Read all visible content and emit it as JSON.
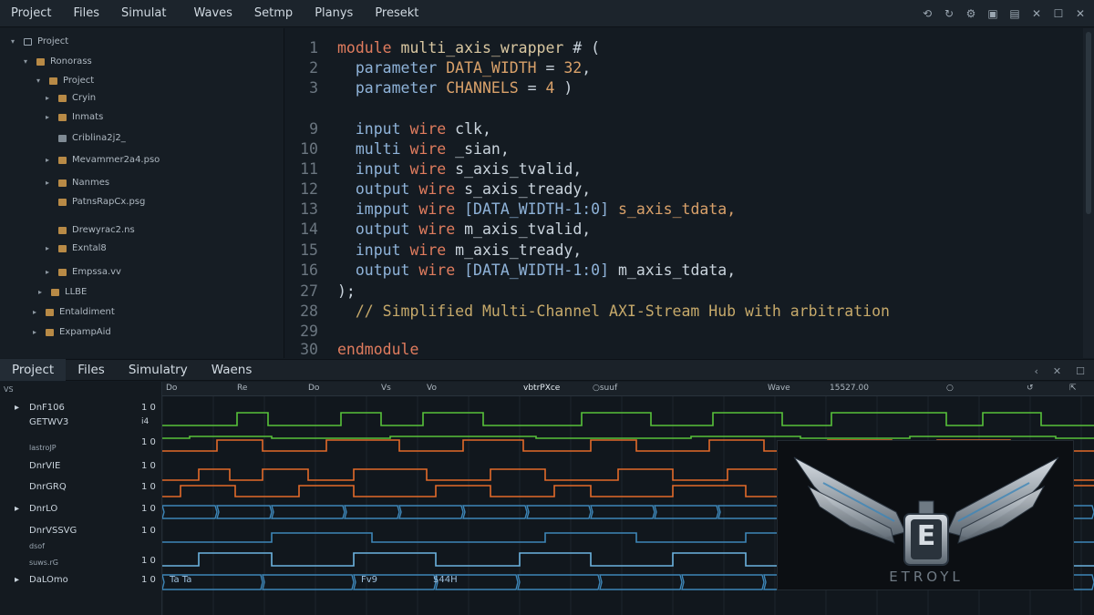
{
  "menubar": {
    "items": [
      "Project",
      "Files",
      "Simulat",
      "Waves",
      "Setmp",
      "Planys",
      "Presekt"
    ],
    "icons": [
      "refresh-icon",
      "sync-icon",
      "gear-icon",
      "save-icon",
      "save-all-icon",
      "close-icon",
      "maximize-icon",
      "close-window-icon"
    ]
  },
  "tree": {
    "items": [
      {
        "label": "Project",
        "sub": ""
      },
      {
        "label": "Ronorass",
        "sub": ""
      },
      {
        "label": "Project",
        "sub": ""
      },
      {
        "label": "Cryin",
        "sub": ""
      },
      {
        "label": "Inmats",
        "sub": ""
      },
      {
        "label": "Criblina2j2_",
        "sub": ""
      },
      {
        "label": "Mevammer2a4.pso",
        "sub": "_"
      },
      {
        "label": "Nanmes",
        "sub": ""
      },
      {
        "label": "PatnsRapCx.psg",
        "sub": "_"
      },
      {
        "label": "Drewyrac2.ns",
        "sub": "_"
      },
      {
        "label": "Exntal8",
        "sub": ""
      },
      {
        "label": "Empssa.vv",
        "sub": ""
      },
      {
        "label": "LLBE",
        "sub": "-"
      },
      {
        "label": "Entaldiment",
        "sub": ""
      },
      {
        "label": "ExpampAid",
        "sub": ""
      }
    ]
  },
  "editor": {
    "line_numbers": [
      "1",
      "2",
      "3",
      "9",
      "10",
      "11",
      "12",
      "13",
      "14",
      "15",
      "16",
      "27",
      "28",
      "29",
      "30"
    ],
    "code": {
      "l1_kw": "module",
      "l1_id": "multi_axis_wrapper",
      "l1_rest": " # (",
      "l2_kw": "parameter",
      "l2_par": "DATA_WIDTH",
      "l2_eq": " = ",
      "l2_num": "32",
      "l2_end": ",",
      "l3_kw": "parameter",
      "l3_par": "CHANNELS",
      "l3_eq": " = ",
      "l3_num": "4",
      "l3_end": " )",
      "l9_a": "input",
      "l9_b": "wire",
      "l9_c": "clk,",
      "l10_a": "multi",
      "l10_b": "wire",
      "l10_c": "_sian,",
      "l11_a": "input",
      "l11_b": "wire",
      "l11_c": "s_axis_tvalid,",
      "l12_a": "output",
      "l12_b": "wire",
      "l12_c": "s_axis_tready,",
      "l13_a": "impput",
      "l13_b": "wire",
      "l13_br": "[DATA_WIDTH-1:0]",
      "l13_c": "s_axis_tdata,",
      "l14_a": "output",
      "l14_b": "wire",
      "l14_c": "m_axis_tvalid,",
      "l15_a": "input",
      "l15_b": "wire",
      "l15_c": "m_axis_tready,",
      "l16_a": "output",
      "l16_b": "wire",
      "l16_br": "[DATA_WIDTH-1:0]",
      "l16_c": "m_axis_tdata,",
      "l27": ");",
      "l28": "// Simplified Multi-Channel AXI-Stream Hub with arbitration",
      "l29": "",
      "l30": "endmodule"
    }
  },
  "bottom_tabs": [
    "Project",
    "Files",
    "Simulatry",
    "Waens"
  ],
  "waves": {
    "ruler": [
      "VS",
      "Do",
      "Re",
      "Do",
      "Vs",
      "Vo",
      "vbtrPXce",
      "○suuf",
      "Wave",
      "15527.00",
      "○",
      "↺",
      "⇱"
    ],
    "signals": [
      {
        "name": "DnF106",
        "val": "1 0",
        "arrow": "▸"
      },
      {
        "name": "GETWV3",
        "val": "i4",
        "arrow": ""
      },
      {
        "name": "lastroJP",
        "val": "1 0",
        "arrow": ""
      },
      {
        "name": "DnrVIE",
        "val": "1 0",
        "arrow": ""
      },
      {
        "name": "DnrGRQ",
        "val": "1 0",
        "arrow": ""
      },
      {
        "name": "DnrLO",
        "val": "1 0",
        "arrow": "▸"
      },
      {
        "name": "DnrVSSVG",
        "val": "1 0",
        "arrow": ""
      },
      {
        "name": "dsof",
        "val": "",
        "arrow": ""
      },
      {
        "name": "suws.rG",
        "val": "1 0",
        "arrow": ""
      },
      {
        "name": "DaLOmo",
        "val": "1 0",
        "arrow": "▸"
      }
    ],
    "bus_labels": [
      "Ta Ta",
      "Fv9",
      "$44H"
    ],
    "colors": {
      "green": "#58c23a",
      "orange": "#e36a2a",
      "blue": "#3d86b8",
      "lightblue": "#6cb4e0"
    }
  },
  "logo": {
    "text": "ETROYL",
    "letter": "E"
  }
}
